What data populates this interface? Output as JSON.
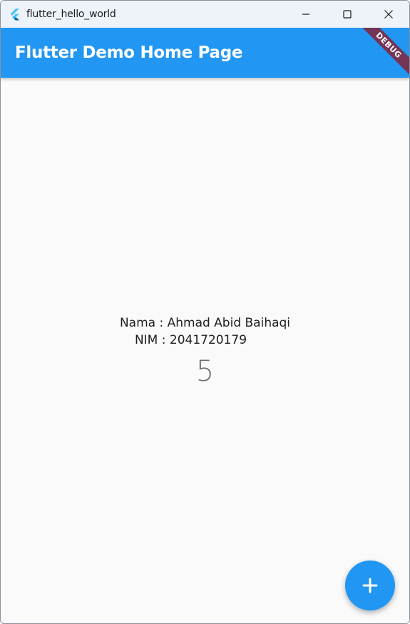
{
  "window": {
    "title": "flutter_hello_world",
    "controls": {
      "minimize": "minimize-icon",
      "maximize": "maximize-icon",
      "close": "close-icon"
    }
  },
  "appbar": {
    "title": "Flutter Demo Home Page",
    "color": "#2196f3",
    "debug_label": "DEBUG"
  },
  "body": {
    "nama": "Nama : Ahmad Abid Baihaqi",
    "nim": "NIM : 2041720179",
    "counter": "5"
  },
  "fab": {
    "icon": "add-icon",
    "color": "#2196f3"
  }
}
